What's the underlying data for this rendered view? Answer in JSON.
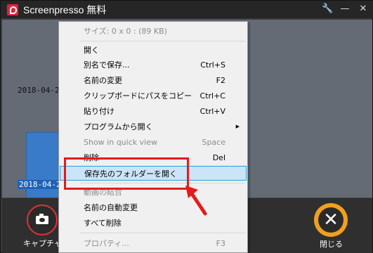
{
  "window": {
    "title": "Screenpresso 無料"
  },
  "titlebar_icons": [
    "wrench-icon",
    "minimize-icon",
    "close-icon"
  ],
  "gallery": {
    "timestamps": [
      "2018-04-29",
      "2018-04-29"
    ]
  },
  "bottom": {
    "capture_label": "キャプチャ",
    "close_label": "閉じる"
  },
  "menu": {
    "header": "サイズ: 0 x 0 : (89 KB)",
    "items": [
      {
        "label": "開く",
        "shortcut": ""
      },
      {
        "label": "別名で保存...",
        "shortcut": "Ctrl+S"
      },
      {
        "label": "名前の変更",
        "shortcut": "F2"
      },
      {
        "label": "クリップボードにパスをコピー",
        "shortcut": "Ctrl+C"
      },
      {
        "label": "貼り付け",
        "shortcut": "Ctrl+V"
      },
      {
        "label": "プログラムから開く",
        "shortcut": ""
      },
      {
        "label": "Show in quick view",
        "shortcut": "Space"
      },
      {
        "label": "削除",
        "shortcut": "Del"
      },
      {
        "label": "保存先のフォルダーを開く",
        "shortcut": ""
      },
      {
        "label": "動画の結合",
        "shortcut": ""
      },
      {
        "label": "名前の自動変更",
        "shortcut": ""
      },
      {
        "label": "すべて削除",
        "shortcut": ""
      },
      {
        "label": "プロパティ...",
        "shortcut": "F3"
      }
    ]
  },
  "colors": {
    "highlight": "#cce4f7",
    "annotation": "#e31b1b",
    "close_ring": "#f0a01e",
    "capture_ring": "#e0323a"
  }
}
